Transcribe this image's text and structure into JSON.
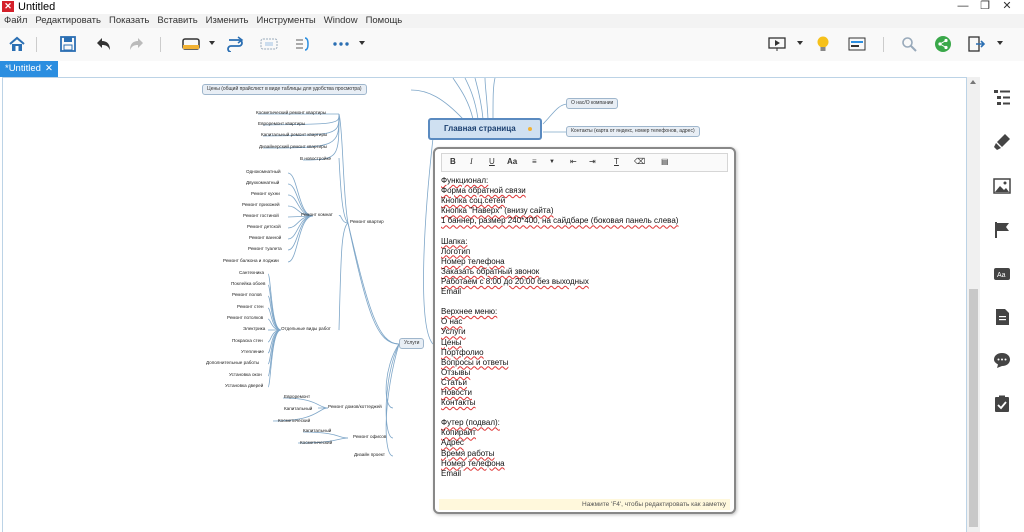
{
  "window": {
    "title": "Untitled",
    "minimize": "—",
    "maximize": "❐",
    "close": "✕"
  },
  "menu": [
    "Файл",
    "Редактировать",
    "Показать",
    "Вставить",
    "Изменить",
    "Инструменты",
    "Window",
    "Помощь"
  ],
  "tab": {
    "label": "*Untitled",
    "close": "✕"
  },
  "mindmap": {
    "central": "Главная страница",
    "top_nodes": {
      "prices": "Цены (общий прайслист в виде таблицы для удобства просмотра)",
      "about": "О нас/О компании",
      "contacts": "Контакты (карта от яндекс, номер телефонов, адрес)"
    },
    "services": "Услуги",
    "apartment_repair": {
      "label": "Ремонт квартир",
      "types": [
        "Косметический ремонт квартиры",
        "Евроремонт квартиры",
        "Капитальный ремонт квартиры",
        "Дизайнерский ремонт квартиры",
        "В новостройке"
      ],
      "rooms_label": "Ремонт комнат",
      "rooms": [
        "Однокомнатный",
        "Двухкомнатный",
        "Ремонт кухни",
        "Ремонт прихожей",
        "Ремонт гостиной",
        "Ремонт детской",
        "Ремонт ванной",
        "Ремонт туалета",
        "Ремонт балкона и лоджии"
      ],
      "works_label": "Отдельные виды работ",
      "works": [
        "Сантехника",
        "Поклейка обоев",
        "Ремонт полов",
        "Ремонт стен",
        "Ремонт потолков",
        "Электрика",
        "Покраска стен",
        "Утепление",
        "Дополнительные работы",
        "Установка окон",
        "Установка дверей"
      ]
    },
    "cottage": {
      "label": "Ремонт домов/коттеджей",
      "items": [
        "Евроремонт",
        "Капитальный",
        "Косметический"
      ]
    },
    "office": {
      "label": "Ремонт офисов",
      "items": [
        "Капитальный",
        "Косметический"
      ]
    },
    "design": "Дизайн проект"
  },
  "note": {
    "lines": [
      "Функционал:",
      "Форма обратной связи",
      "Кнопка соц.сетей",
      "Кнопка \"Наверх\" (внизу сайта)",
      "1 баннер, размер 240*400, на сайдбаре (боковая панель слева)",
      "",
      "Шапка:",
      "Логотип",
      "Номер телефона",
      "Заказать обратный звонок",
      "Работаем с 8:00 до 20:00 без выходных",
      "Email",
      "",
      "Верхнее меню:",
      "О нас",
      "Услуги",
      "Цены",
      "Портфолио",
      "Вопросы и ответы",
      "Отзывы",
      "Статьи",
      "Новости",
      "Контакты",
      "",
      "Футер (подвал):",
      "Копирайт",
      "Адрес",
      "Время работы",
      "Номер телефона",
      "Email"
    ],
    "footer": "Нажмите 'F4', чтобы редактировать как заметку"
  },
  "colors": {
    "accent": "#2b8ee0",
    "central_border": "#5a8ac0",
    "branch": "#7ea6c8"
  }
}
